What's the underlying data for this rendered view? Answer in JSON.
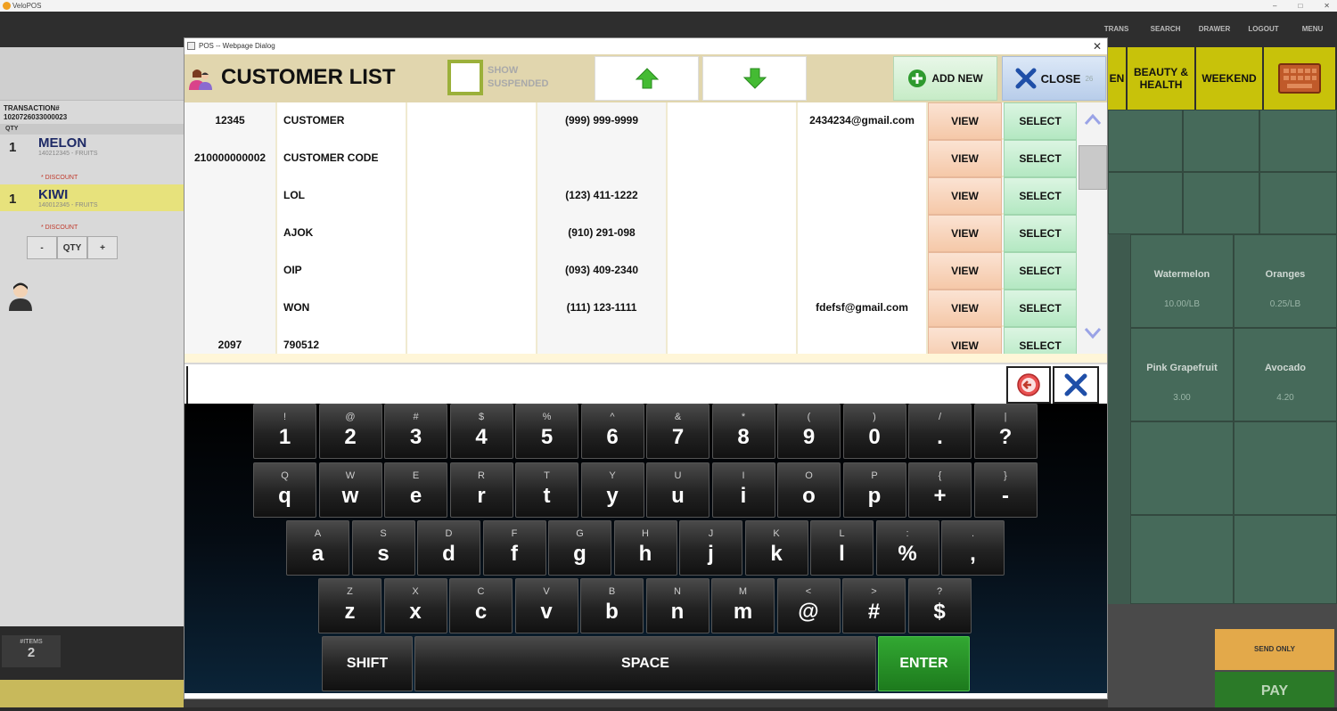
{
  "window": {
    "title": "VeloPOS"
  },
  "top_menu": [
    "TRANS",
    "SEARCH",
    "DRAWER",
    "LOGOUT",
    "MENU"
  ],
  "transaction": {
    "label": "TRANSACTION#",
    "number": "1020726033000023",
    "qty_header": "QTY"
  },
  "items": [
    {
      "qty": "1",
      "name": "MELON",
      "sub": "140212345 - FRUITS",
      "discount": "* DISCOUNT"
    },
    {
      "qty": "1",
      "name": "KIWI",
      "sub": "140012345 - FRUITS",
      "discount": "* DISCOUNT"
    }
  ],
  "qty_controls": [
    "-",
    "QTY",
    "+"
  ],
  "items_count": {
    "label": "#ITEMS",
    "value": "2"
  },
  "categories": [
    "EN",
    "BEAUTY & HEALTH",
    "WEEKEND"
  ],
  "products": [
    {
      "name": "Watermelon",
      "price": "10.00/LB"
    },
    {
      "name": "Oranges",
      "price": "0.25/LB"
    },
    {
      "name": "Pink Grapefruit",
      "price": "3.00"
    },
    {
      "name": "Avocado",
      "price": "4.20"
    }
  ],
  "send_only": "SEND ONLY",
  "pay": "PAY",
  "dialog": {
    "title": "POS -- Webpage Dialog",
    "heading": "CUSTOMER LIST",
    "show_suspended": "SHOW SUSPENDED",
    "add_new": "ADD NEW",
    "close": "CLOSE",
    "close_count": "26"
  },
  "customers": [
    {
      "code": "12345",
      "name": "CUSTOMER",
      "phone": "(999) 999-9999",
      "email": "2434234@gmail.com"
    },
    {
      "code": "210000000002",
      "name": "CUSTOMER CODE",
      "phone": "",
      "email": ""
    },
    {
      "code": "",
      "name": "LOL",
      "phone": "(123) 411-1222",
      "email": ""
    },
    {
      "code": "",
      "name": "AJOK",
      "phone": "(910) 291-098",
      "email": ""
    },
    {
      "code": "",
      "name": "OIP",
      "phone": "(093) 409-2340",
      "email": ""
    },
    {
      "code": "",
      "name": "WON",
      "phone": "(111) 123-1111",
      "email": "fdefsf@gmail.com"
    },
    {
      "code": "2097",
      "name": "790512",
      "phone": "",
      "email": ""
    }
  ],
  "row_buttons": {
    "view": "VIEW",
    "select": "SELECT"
  },
  "keyboard": {
    "rows": [
      [
        [
          "!",
          "1"
        ],
        [
          "@",
          "2"
        ],
        [
          "#",
          "3"
        ],
        [
          "$",
          "4"
        ],
        [
          "%",
          "5"
        ],
        [
          "^",
          "6"
        ],
        [
          "&",
          "7"
        ],
        [
          "*",
          "8"
        ],
        [
          "(",
          "9"
        ],
        [
          ")",
          "0"
        ],
        [
          "/",
          "."
        ],
        [
          "|",
          "?"
        ]
      ],
      [
        [
          "Q",
          "q"
        ],
        [
          "W",
          "w"
        ],
        [
          "E",
          "e"
        ],
        [
          "R",
          "r"
        ],
        [
          "T",
          "t"
        ],
        [
          "Y",
          "y"
        ],
        [
          "U",
          "u"
        ],
        [
          "I",
          "i"
        ],
        [
          "O",
          "o"
        ],
        [
          "P",
          "p"
        ],
        [
          "{",
          "+"
        ],
        [
          "}",
          "-"
        ]
      ],
      [
        [
          "A",
          "a"
        ],
        [
          "S",
          "s"
        ],
        [
          "D",
          "d"
        ],
        [
          "F",
          "f"
        ],
        [
          "G",
          "g"
        ],
        [
          "H",
          "h"
        ],
        [
          "J",
          "j"
        ],
        [
          "K",
          "k"
        ],
        [
          "L",
          "l"
        ],
        [
          ":",
          "%"
        ],
        [
          ".",
          ","
        ]
      ],
      [
        [
          "Z",
          "z"
        ],
        [
          "X",
          "x"
        ],
        [
          "C",
          "c"
        ],
        [
          "V",
          "v"
        ],
        [
          "B",
          "b"
        ],
        [
          "N",
          "n"
        ],
        [
          "M",
          "m"
        ],
        [
          "<",
          "@"
        ],
        [
          ">",
          "#"
        ],
        [
          "?",
          "$"
        ]
      ]
    ],
    "shift": "SHIFT",
    "space": "SPACE",
    "enter": "ENTER"
  },
  "colors": {
    "header_bg": "#e1d6ae",
    "category": "#c8c20a",
    "tile_bg": "#466a5a",
    "enter": "#2a9a2a"
  }
}
